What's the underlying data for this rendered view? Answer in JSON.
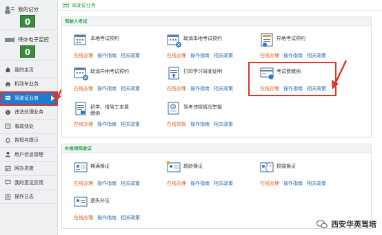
{
  "sidebar": {
    "score": {
      "label": "我的记分",
      "value": "0"
    },
    "monitor": {
      "label": "待办电子监控",
      "value": "0"
    },
    "items": [
      {
        "label": "我的主页",
        "icon": "home-icon"
      },
      {
        "label": "机动车业务",
        "icon": "car-icon"
      },
      {
        "label": "驾驶证业务",
        "icon": "license-icon",
        "active": true
      },
      {
        "label": "违法处理业务",
        "icon": "warning-icon"
      },
      {
        "label": "事故快处",
        "icon": "accident-icon"
      },
      {
        "label": "告知与提示",
        "icon": "bell-icon"
      },
      {
        "label": "用户信息管理",
        "icon": "user-icon"
      },
      {
        "label": "网办进度",
        "icon": "progress-icon"
      },
      {
        "label": "我的意见反馈",
        "icon": "feedback-icon"
      },
      {
        "label": "操作日志",
        "icon": "log-icon"
      }
    ]
  },
  "breadcrumb": "驾驶证业务",
  "sections": [
    {
      "title": "驾驶人考试",
      "services": [
        {
          "title": "本地考试预约",
          "icon": "calendar-icon",
          "online": "在线办理"
        },
        {
          "title": "取消本地考试预约",
          "icon": "calendar-cancel-icon",
          "online": "在线办理"
        },
        {
          "title": "异地考试预约",
          "icon": "id-card-icon",
          "online": "在线办理"
        },
        {
          "title": "取消异地考试预约",
          "icon": "calendar-cancel-icon",
          "online": "在线办理"
        },
        {
          "title": "打印学习驾驶证明",
          "icon": "print-icon",
          "online": "在线办理"
        },
        {
          "title": "考试费缴纳",
          "icon": "payment-card-icon",
          "online": "在线办理"
        },
        {
          "title": "初学、增驾工本费",
          "title2": "缴纳",
          "icon": "document-icon",
          "online": "在线办理"
        },
        {
          "title": "驾考违规情况举报",
          "icon": "report-icon",
          "online": "在线举报"
        }
      ]
    },
    {
      "title": "补换领驾驶证",
      "services": [
        {
          "title": "期满换证",
          "icon": "renew-card-icon",
          "online": "在线办理"
        },
        {
          "title": "超龄换证",
          "icon": "age-card-icon",
          "online": "在线办理"
        },
        {
          "title": "损毁换证",
          "icon": "damaged-card-icon",
          "online": "在线办理"
        },
        {
          "title": "遗失补证",
          "icon": "lost-card-icon",
          "online": "在线办理"
        }
      ]
    }
  ],
  "links": {
    "guide": "操作指南",
    "policy": "相关政策"
  },
  "watermark": "西安华英驾培",
  "colors": {
    "accent_green": "#2aa44b",
    "online_orange": "#e05a17",
    "link_blue": "#2a6bb5",
    "highlight_red": "#e0332b",
    "nav_active": "#1f7bd0"
  }
}
